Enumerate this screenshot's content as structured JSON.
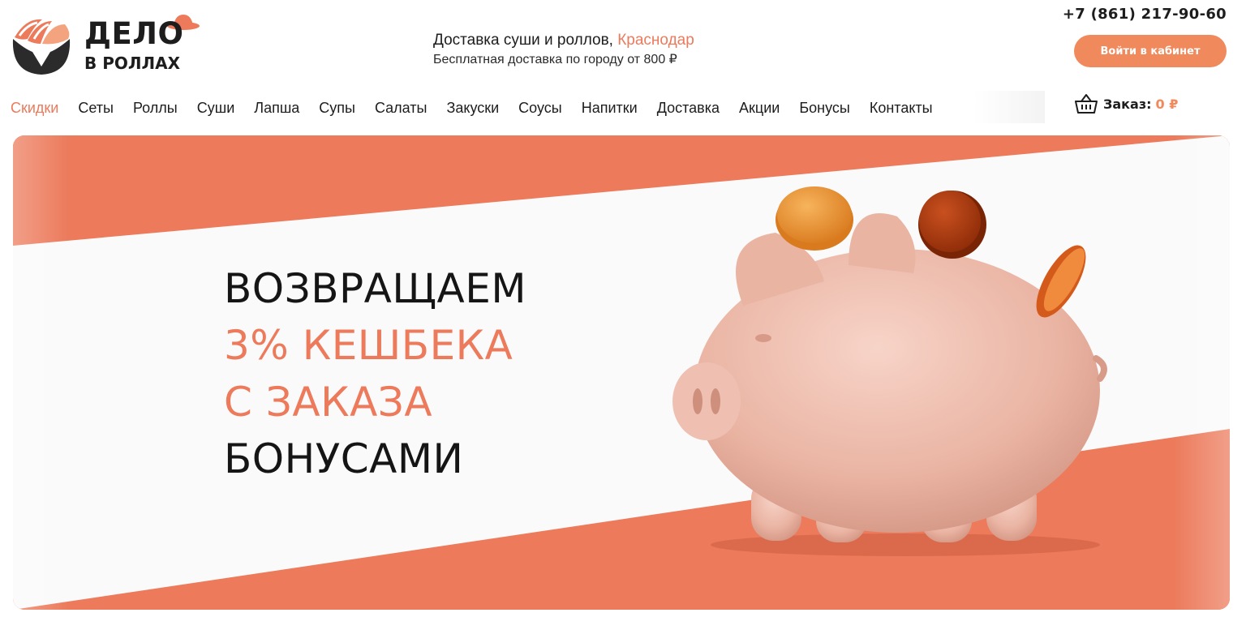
{
  "header": {
    "logo_line1": "ДЕЛО",
    "logo_line2": "В РОЛЛАХ",
    "delivery_title": "Доставка суши и роллов,",
    "delivery_city": "Краснодар",
    "delivery_note": "Бесплатная доставка по городу от 800 ₽",
    "phone": "+7 (861) 217-90-60",
    "login_label": "Войти в кабинет"
  },
  "nav": {
    "items": [
      {
        "label": "Скидки",
        "active": true
      },
      {
        "label": "Сеты"
      },
      {
        "label": "Роллы"
      },
      {
        "label": "Суши"
      },
      {
        "label": "Лапша"
      },
      {
        "label": "Супы"
      },
      {
        "label": "Салаты"
      },
      {
        "label": "Закуски"
      },
      {
        "label": "Соусы"
      },
      {
        "label": "Напитки"
      },
      {
        "label": "Доставка"
      },
      {
        "label": "Акции"
      },
      {
        "label": "Бонусы"
      },
      {
        "label": "Контакты"
      }
    ]
  },
  "cart": {
    "icon": "basket-icon",
    "label": "Заказ:",
    "sum": "0 ₽"
  },
  "banner": {
    "line1": "ВОЗВРАЩАЕМ",
    "line2": "3% КЕШБЕКА",
    "line3": "С ЗАКАЗА",
    "line4": "БОНУСАМИ",
    "image": "piggy-bank-with-coins"
  },
  "colors": {
    "accent": "#ec7a5b",
    "button": "#f0895c",
    "text": "#1d1d1d"
  }
}
